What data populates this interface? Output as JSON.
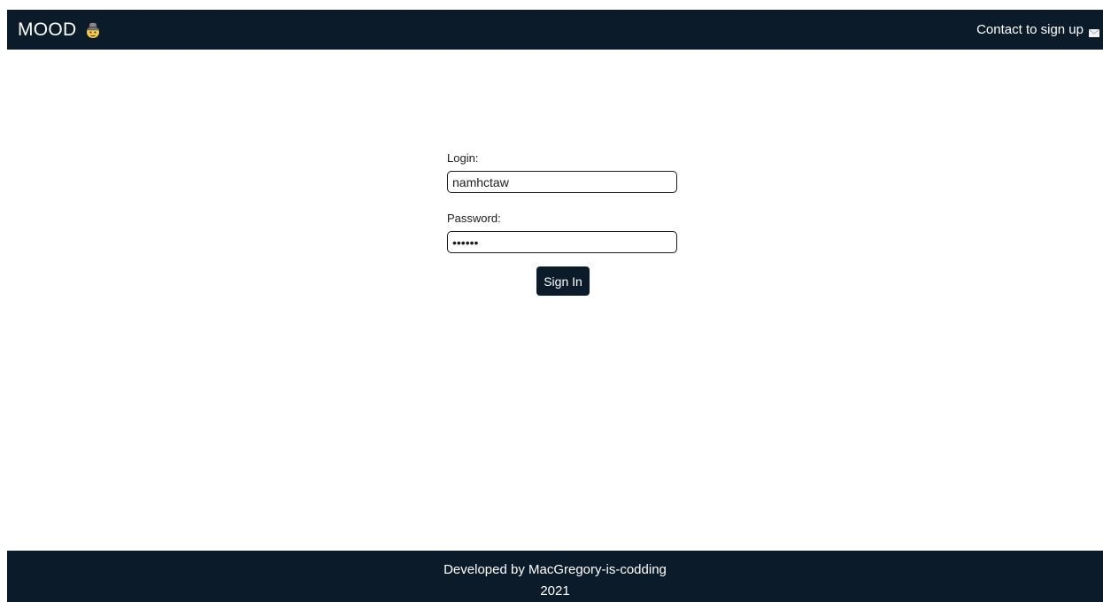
{
  "navbar": {
    "brand": "MOOD",
    "brand_icon": "detective-emoji-icon",
    "contact_label": "Contact to sign up",
    "contact_icon": "envelope-icon"
  },
  "form": {
    "login_label": "Login:",
    "login_value": "namhctaw",
    "password_label": "Password:",
    "password_value": "••••••",
    "submit_label": "Sign In"
  },
  "footer": {
    "credit": "Developed by MacGregory-is-codding",
    "year": "2021"
  },
  "colors": {
    "primary": "#0c1b2a",
    "background": "#ffffff",
    "text": "#1c1c1c"
  }
}
